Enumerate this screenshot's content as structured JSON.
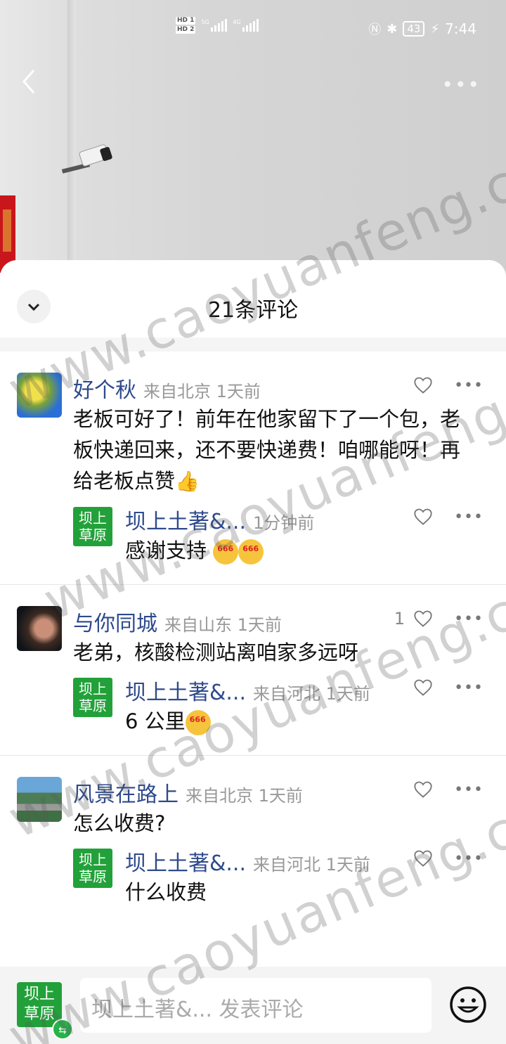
{
  "status_bar": {
    "hd1": "HD 1",
    "hd2": "HD 2",
    "sim1_gen": "5G",
    "sim2_gen": "4G",
    "battery": "43",
    "time": "7:44"
  },
  "video": {
    "back_icon": "chevron-left-icon",
    "more_icon": "more-horizontal-icon"
  },
  "sheet": {
    "title": "21条评论",
    "collapse_icon": "chevron-down-icon"
  },
  "comments": [
    {
      "user": "好个秋",
      "meta": "来自北京 1天前",
      "text": "老板可好了！前年在他家留下了一个包，老板快递回来，还不要快递费！咱哪能呀！再给老板点赞",
      "likes": "",
      "reply": {
        "badge": "坝上草原",
        "user": "坝上土著&...",
        "meta": "1分钟前",
        "text": "感谢支持"
      }
    },
    {
      "user": "与你同城",
      "meta": "来自山东 1天前",
      "text": "老弟，核酸检测站离咱家多远呀",
      "likes": "1",
      "reply": {
        "badge": "坝上草原",
        "user": "坝上土著&...",
        "meta": "来自河北 1天前",
        "text": "6 公里"
      }
    },
    {
      "user": "风景在路上",
      "meta": "来自北京 1天前",
      "text": "怎么收费?",
      "likes": "",
      "reply": {
        "badge": "坝上草原",
        "user": "坝上土著&...",
        "meta": "来自河北 1天前",
        "text": "什么收费"
      }
    }
  ],
  "bottom_bar": {
    "avatar_badge": "坝上草原",
    "placeholder": "坝上土著&... 发表评论",
    "emoji_icon": "smiley-icon"
  },
  "watermark": "www.caoyuanfeng.com",
  "colors": {
    "username": "#2e4a8c",
    "badge_green": "#22a13a",
    "meta_gray": "#999999"
  }
}
